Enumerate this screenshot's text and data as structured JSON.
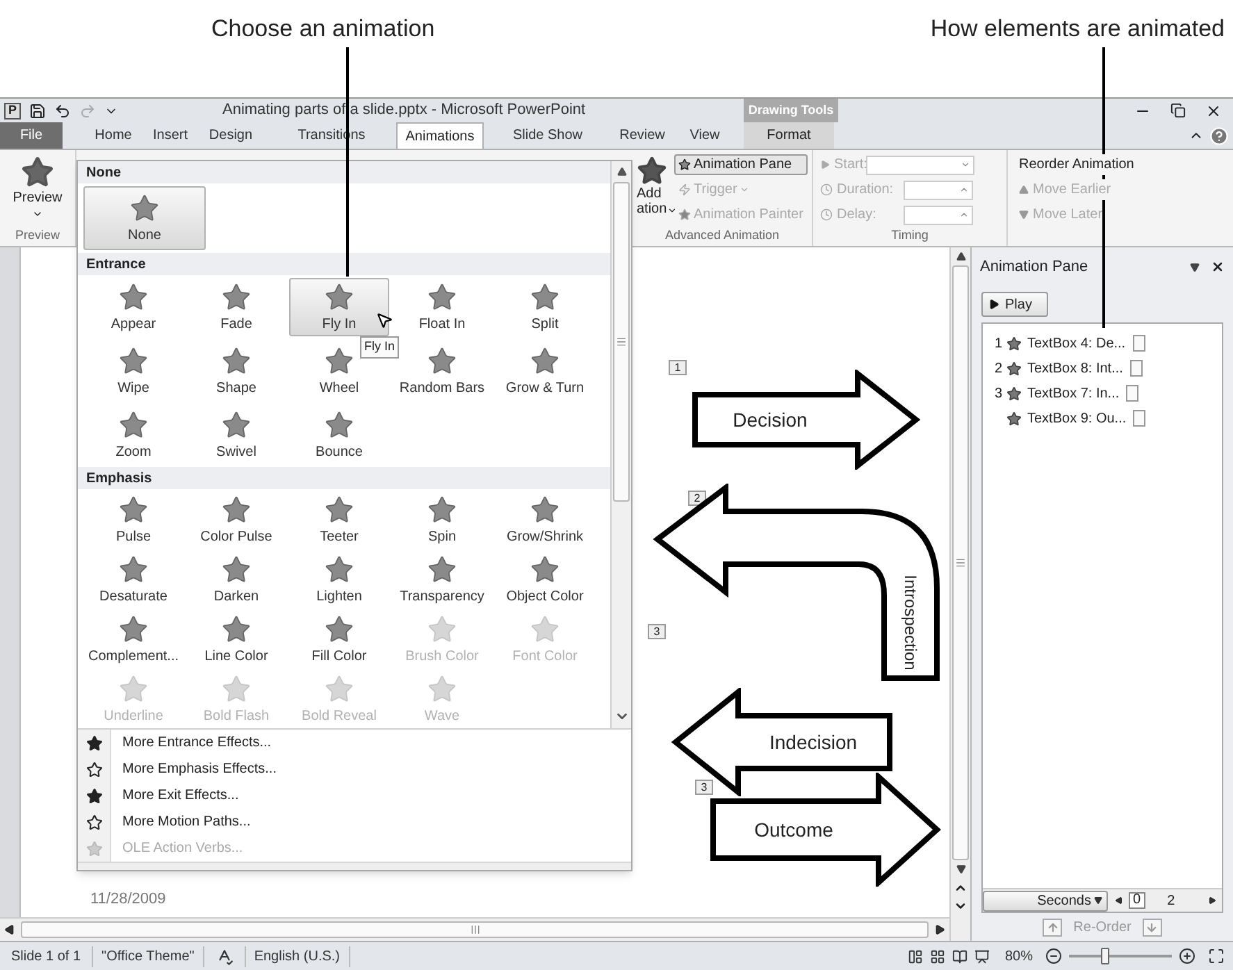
{
  "callouts": [
    {
      "text": "Choose an animation"
    },
    {
      "text": "How elements are animated"
    }
  ],
  "window": {
    "app_icon": "P",
    "title": "Animating parts of a slide.pptx - Microsoft PowerPoint",
    "context_tab_group": "Drawing Tools"
  },
  "tabs": [
    {
      "label": "File",
      "kind": "file",
      "selected": false
    },
    {
      "label": "Home",
      "kind": "normal",
      "selected": false
    },
    {
      "label": "Insert",
      "kind": "normal",
      "selected": false
    },
    {
      "label": "Design",
      "kind": "normal",
      "selected": false
    },
    {
      "label": "Transitions",
      "kind": "normal",
      "selected": false
    },
    {
      "label": "Animations",
      "kind": "normal",
      "selected": true
    },
    {
      "label": "Slide Show",
      "kind": "normal",
      "selected": false
    },
    {
      "label": "Review",
      "kind": "normal",
      "selected": false
    },
    {
      "label": "View",
      "kind": "normal",
      "selected": false
    },
    {
      "label": "Format",
      "kind": "context",
      "selected": false
    }
  ],
  "ribbon": {
    "preview": {
      "button": "Preview",
      "group": "Preview"
    },
    "add_animation": {
      "line_1": "Add",
      "line_2": "ation"
    },
    "advanced_buttons": [
      {
        "label": "Animation Pane",
        "kind": "button",
        "on": true,
        "disabled": false
      },
      {
        "label": "Trigger",
        "kind": "dropdown",
        "on": false,
        "disabled": true
      },
      {
        "label": "Animation Painter",
        "kind": "button",
        "on": false,
        "disabled": true
      }
    ],
    "advanced_group": "Advanced Animation",
    "timing_fields": [
      {
        "label": "Start:",
        "kind": "dropdown",
        "disabled": true
      },
      {
        "label": "Duration:",
        "kind": "spinner",
        "disabled": true
      },
      {
        "label": "Delay:",
        "kind": "spinner",
        "disabled": true
      }
    ],
    "timing_group": "Timing",
    "reorder_title": "Reorder Animation",
    "reorder_buttons": [
      {
        "label": "Move Earlier",
        "kind": "up",
        "disabled": true
      },
      {
        "label": "Move Later",
        "kind": "down",
        "disabled": true
      }
    ]
  },
  "gallery": {
    "sections": [
      {
        "title": "None",
        "items": [
          {
            "label": "None",
            "selected": true,
            "disabled": false
          }
        ]
      },
      {
        "title": "Entrance",
        "items": [
          {
            "label": "Appear",
            "selected": false,
            "disabled": false
          },
          {
            "label": "Fade",
            "selected": false,
            "disabled": false
          },
          {
            "label": "Fly In",
            "selected": true,
            "disabled": false
          },
          {
            "label": "Float In",
            "selected": false,
            "disabled": false
          },
          {
            "label": "Split",
            "selected": false,
            "disabled": false
          },
          {
            "label": "Wipe",
            "selected": false,
            "disabled": false
          },
          {
            "label": "Shape",
            "selected": false,
            "disabled": false
          },
          {
            "label": "Wheel",
            "selected": false,
            "disabled": false
          },
          {
            "label": "Random Bars",
            "selected": false,
            "disabled": false
          },
          {
            "label": "Grow & Turn",
            "selected": false,
            "disabled": false
          },
          {
            "label": "Zoom",
            "selected": false,
            "disabled": false
          },
          {
            "label": "Swivel",
            "selected": false,
            "disabled": false
          },
          {
            "label": "Bounce",
            "selected": false,
            "disabled": false
          }
        ]
      },
      {
        "title": "Emphasis",
        "items": [
          {
            "label": "Pulse",
            "selected": false,
            "disabled": false
          },
          {
            "label": "Color Pulse",
            "selected": false,
            "disabled": false
          },
          {
            "label": "Teeter",
            "selected": false,
            "disabled": false
          },
          {
            "label": "Spin",
            "selected": false,
            "disabled": false
          },
          {
            "label": "Grow/Shrink",
            "selected": false,
            "disabled": false
          },
          {
            "label": "Desaturate",
            "selected": false,
            "disabled": false
          },
          {
            "label": "Darken",
            "selected": false,
            "disabled": false
          },
          {
            "label": "Lighten",
            "selected": false,
            "disabled": false
          },
          {
            "label": "Transparency",
            "selected": false,
            "disabled": false
          },
          {
            "label": "Object Color",
            "selected": false,
            "disabled": false
          },
          {
            "label": "Complement...",
            "selected": false,
            "disabled": false
          },
          {
            "label": "Line Color",
            "selected": false,
            "disabled": false
          },
          {
            "label": "Fill Color",
            "selected": false,
            "disabled": false
          },
          {
            "label": "Brush Color",
            "selected": false,
            "disabled": true
          },
          {
            "label": "Font Color",
            "selected": false,
            "disabled": true
          },
          {
            "label": "Underline",
            "selected": false,
            "disabled": true
          },
          {
            "label": "Bold Flash",
            "selected": false,
            "disabled": true
          },
          {
            "label": "Bold Reveal",
            "selected": false,
            "disabled": true
          },
          {
            "label": "Wave",
            "selected": false,
            "disabled": true
          }
        ]
      }
    ],
    "tooltip": "Fly In",
    "menu": [
      {
        "label": "More Entrance Effects...",
        "disabled": false
      },
      {
        "label": "More Emphasis Effects...",
        "disabled": false
      },
      {
        "label": "More Exit Effects...",
        "disabled": false
      },
      {
        "label": "More Motion Paths...",
        "disabled": false
      },
      {
        "label": "OLE Action Verbs...",
        "disabled": true
      }
    ]
  },
  "slide": {
    "shapes": [
      {
        "kind": "right-arrow",
        "text": "Decision",
        "tag": "1"
      },
      {
        "kind": "u-turn-arrow",
        "text": "Introspection",
        "tag": "2"
      },
      {
        "kind": "left-arrow",
        "text": "Indecision",
        "tag": "3"
      },
      {
        "kind": "right-arrow",
        "text": "Outcome",
        "tag": "3"
      }
    ],
    "date": "11/28/2009"
  },
  "animation_pane": {
    "title": "Animation Pane",
    "play": "Play",
    "items": [
      {
        "number": "1",
        "label": "TextBox 4: De..."
      },
      {
        "number": "2",
        "label": "TextBox 8: Int..."
      },
      {
        "number": "3",
        "label": "TextBox 7: In..."
      },
      {
        "label": "TextBox 9: Ou..."
      }
    ],
    "seconds": "Seconds",
    "timeline": [
      "0",
      "2"
    ],
    "reorder": "Re-Order"
  },
  "status_bar": {
    "slide": "Slide 1 of 1",
    "theme": "\"Office Theme\"",
    "language": "English (U.S.)",
    "zoom": "80%",
    "zoom_slider": {
      "level": 0.35
    }
  }
}
